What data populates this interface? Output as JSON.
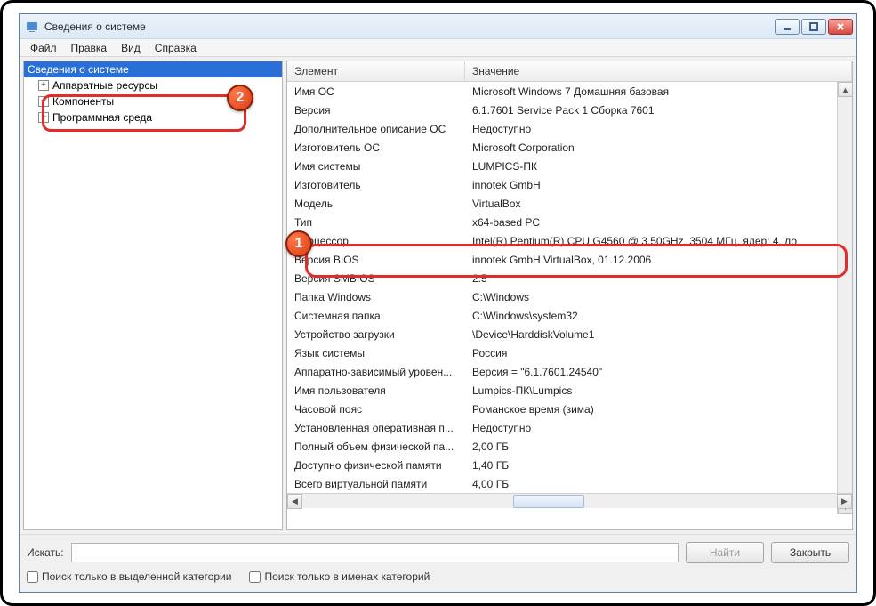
{
  "window": {
    "title": "Сведения о системе"
  },
  "menu": {
    "file": "Файл",
    "edit": "Правка",
    "view": "Вид",
    "help": "Справка"
  },
  "tree": {
    "root": "Сведения о системе",
    "hw": "Аппаратные ресурсы",
    "components": "Компоненты",
    "software": "Программная среда"
  },
  "columns": {
    "element": "Элемент",
    "value": "Значение"
  },
  "rows": [
    {
      "k": "Имя ОС",
      "v": "Microsoft Windows 7 Домашняя базовая"
    },
    {
      "k": "Версия",
      "v": "6.1.7601 Service Pack 1 Сборка 7601"
    },
    {
      "k": "Дополнительное описание ОС",
      "v": "Недоступно"
    },
    {
      "k": "Изготовитель ОС",
      "v": "Microsoft Corporation"
    },
    {
      "k": "Имя системы",
      "v": "LUMPICS-ПК"
    },
    {
      "k": "Изготовитель",
      "v": "innotek GmbH"
    },
    {
      "k": "Модель",
      "v": "VirtualBox"
    },
    {
      "k": "Тип",
      "v": "x64-based PC"
    },
    {
      "k": "Процессор",
      "v": "Intel(R) Pentium(R) CPU G4560 @ 3.50GHz, 3504 МГц, ядер: 4, ло"
    },
    {
      "k": "Версия BIOS",
      "v": "innotek GmbH VirtualBox, 01.12.2006"
    },
    {
      "k": "Версия SMBIOS",
      "v": "2.5"
    },
    {
      "k": "Папка Windows",
      "v": "C:\\Windows"
    },
    {
      "k": "Системная папка",
      "v": "C:\\Windows\\system32"
    },
    {
      "k": "Устройство загрузки",
      "v": "\\Device\\HarddiskVolume1"
    },
    {
      "k": "Язык системы",
      "v": "Россия"
    },
    {
      "k": "Аппаратно-зависимый уровен...",
      "v": "Версия = \"6.1.7601.24540\""
    },
    {
      "k": "Имя пользователя",
      "v": "Lumpics-ПК\\Lumpics"
    },
    {
      "k": "Часовой пояс",
      "v": "Романское время (зима)"
    },
    {
      "k": "Установленная оперативная п...",
      "v": "Недоступно"
    },
    {
      "k": "Полный объем физической па...",
      "v": "2,00 ГБ"
    },
    {
      "k": "Доступно физической памяти",
      "v": "1,40 ГБ"
    },
    {
      "k": "Всего виртуальной памяти",
      "v": "4,00 ГБ"
    }
  ],
  "search": {
    "label": "Искать:",
    "find": "Найти",
    "close": "Закрыть",
    "cat_only": "Поиск только в выделенной категории",
    "names_only": "Поиск только в именах категорий"
  },
  "annot": {
    "one": "1",
    "two": "2"
  }
}
